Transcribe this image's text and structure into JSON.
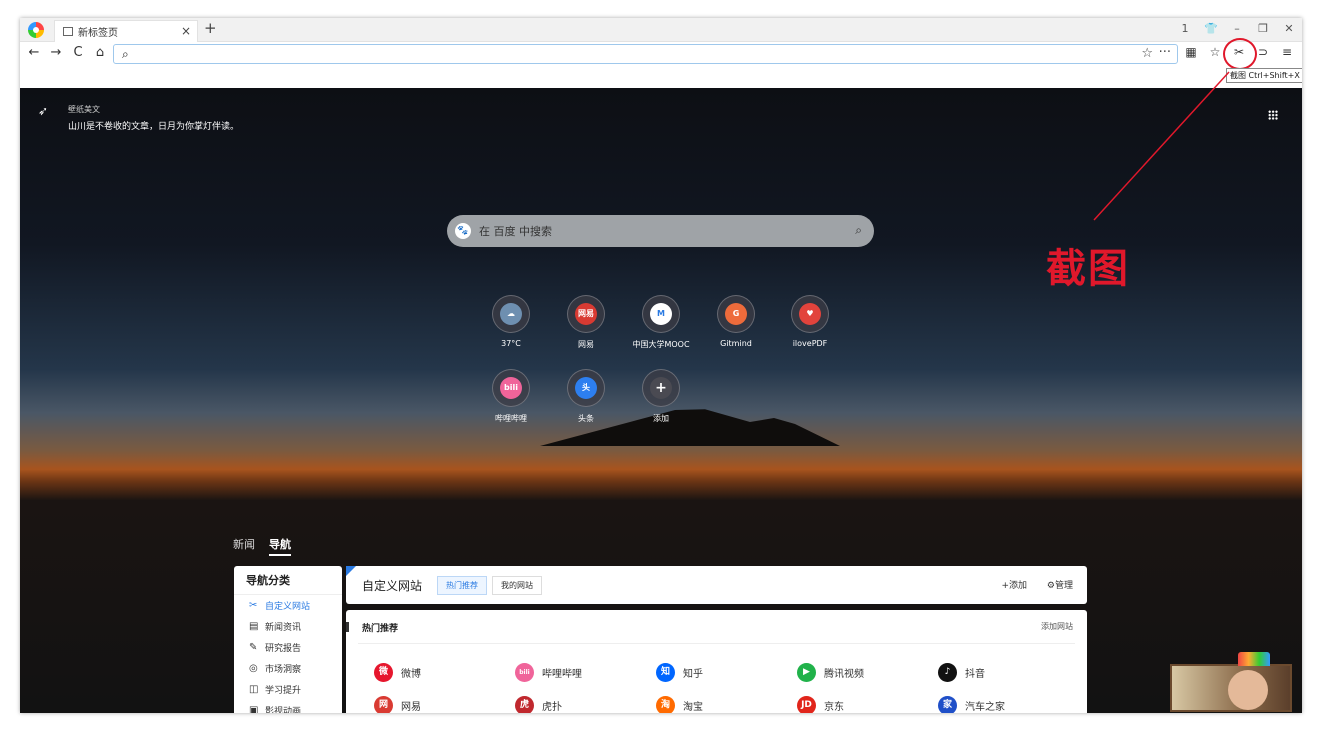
{
  "tab": {
    "title": "新标签页",
    "close": "×",
    "new": "+"
  },
  "window_controls": [
    "1",
    "👕",
    "–",
    "❐",
    "✕"
  ],
  "toolbar": {
    "nav": [
      "←",
      "→",
      "C",
      "⌂"
    ],
    "address_value": "",
    "tools": [
      "▦",
      "☆",
      "✂",
      "⊃",
      "≡"
    ],
    "screenshot_tooltip": "截图 Ctrl+Shift+X"
  },
  "wallpaper": {
    "title": "壁纸美文",
    "text": "山川是不卷收的文章，日月为你掌灯伴读。"
  },
  "search": {
    "placeholder": "在 百度 中搜索"
  },
  "shortcuts": [
    {
      "label": "37°C",
      "icon": "cloud-icon",
      "color": "#6e8fb0",
      "glyph": "☁"
    },
    {
      "label": "网易",
      "icon": "netease-icon",
      "color": "#d93a32",
      "glyph": "网易"
    },
    {
      "label": "中国大学MOOC",
      "icon": "mooc-icon",
      "color": "#ffffff",
      "glyph": "M"
    },
    {
      "label": "Gitmind",
      "icon": "gitmind-icon",
      "color": "#ee6b3b",
      "glyph": "G"
    },
    {
      "label": "ilovePDF",
      "icon": "ilovepdf-icon",
      "color": "#e2433c",
      "glyph": "♥"
    },
    {
      "label": "哔哩哔哩",
      "icon": "bilibili-icon",
      "color": "#f0649a",
      "glyph": "bili"
    },
    {
      "label": "头条",
      "icon": "toutiao-icon",
      "color": "#2d7ff0",
      "glyph": "头"
    },
    {
      "label": "添加",
      "icon": "add-icon",
      "color": "#4a4a52",
      "glyph": "+"
    }
  ],
  "feed_tabs": [
    "新闻",
    "导航"
  ],
  "categories": {
    "header": "导航分类",
    "items": [
      {
        "label": "自定义网站",
        "glyph": "✂"
      },
      {
        "label": "新闻资讯",
        "glyph": "▤"
      },
      {
        "label": "研究报告",
        "glyph": "✎"
      },
      {
        "label": "市场洞察",
        "glyph": "◎"
      },
      {
        "label": "学习提升",
        "glyph": "◫"
      },
      {
        "label": "影视动画",
        "glyph": "▣"
      }
    ]
  },
  "custom_sites": {
    "title": "自定义网站",
    "pills": [
      "热门推荐",
      "我的网站"
    ],
    "add": "+添加",
    "manage": "⚙管理"
  },
  "hot": {
    "title": "热门推荐",
    "add_site": "添加网站",
    "sites": [
      {
        "label": "微博",
        "glyph": "微",
        "color": "#e6162d"
      },
      {
        "label": "哔哩哔哩",
        "glyph": "bili",
        "color": "#f0649a"
      },
      {
        "label": "知乎",
        "glyph": "知",
        "color": "#0066ff"
      },
      {
        "label": "腾讯视频",
        "glyph": "▶",
        "color": "#20b24a"
      },
      {
        "label": "抖音",
        "glyph": "♪",
        "color": "#111111"
      },
      {
        "label": "网易",
        "glyph": "网",
        "color": "#d93a32"
      },
      {
        "label": "虎扑",
        "glyph": "虎",
        "color": "#c0282e"
      },
      {
        "label": "淘宝",
        "glyph": "淘",
        "color": "#ff6a00"
      },
      {
        "label": "京东",
        "glyph": "JD",
        "color": "#e1251b"
      },
      {
        "label": "汽车之家",
        "glyph": "家",
        "color": "#1f4fc8"
      }
    ]
  },
  "annotation": {
    "text": "截图",
    "color": "#e0182b"
  }
}
